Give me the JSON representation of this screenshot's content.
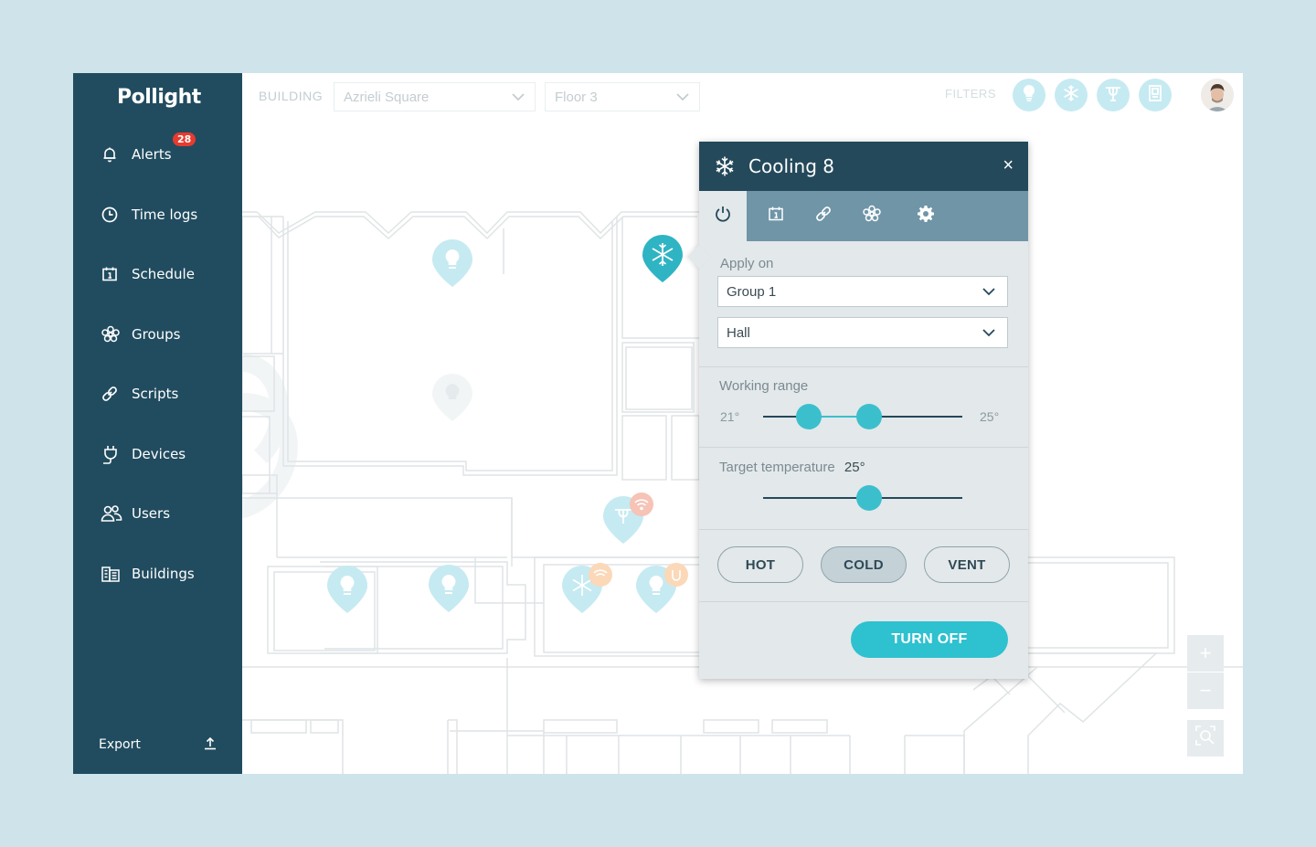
{
  "app": {
    "logo": "Pollight"
  },
  "sidebar": {
    "items": [
      {
        "label": "Alerts",
        "icon": "bell-icon",
        "badge": "28"
      },
      {
        "label": "Time logs",
        "icon": "clock-icon"
      },
      {
        "label": "Schedule",
        "icon": "calendar-icon"
      },
      {
        "label": "Groups",
        "icon": "groups-icon"
      },
      {
        "label": "Scripts",
        "icon": "link-icon"
      },
      {
        "label": "Devices",
        "icon": "plug-icon"
      },
      {
        "label": "Users",
        "icon": "users-icon"
      },
      {
        "label": "Buildings",
        "icon": "buildings-icon"
      }
    ],
    "export_label": "Export"
  },
  "topbar": {
    "building_label": "BUILDING",
    "building_value": "Azrieli Square",
    "floor_value": "Floor 3",
    "filters_label": "FILTERS",
    "filters": [
      "lightbulb-icon",
      "snowflake-icon",
      "fan-icon",
      "door-icon"
    ]
  },
  "panel": {
    "title": "Cooling 8",
    "close": "×",
    "tabs": [
      "power-icon",
      "calendar-icon",
      "link-icon",
      "groups-icon",
      "gear-icon"
    ],
    "active_tab": 0,
    "apply_on_label": "Apply on",
    "group_value": "Group 1",
    "area_value": "Hall",
    "working_range": {
      "label": "Working range",
      "min_label": "21°",
      "max_label": "25°",
      "low_fraction": 0.23,
      "high_fraction": 0.53
    },
    "target": {
      "label": "Target temperature",
      "value": "25°",
      "fraction": 0.53
    },
    "modes": [
      "HOT",
      "COLD",
      "VENT"
    ],
    "active_mode": "COLD",
    "turn_off_label": "TURN OFF"
  },
  "zoom": {
    "in": "+",
    "out": "−"
  },
  "colors": {
    "sidebar": "#214c5f",
    "accent": "#3cbfcd",
    "badge": "#e63b2e",
    "panel_header": "#24495b",
    "tabs_bg": "#6f95a7"
  }
}
